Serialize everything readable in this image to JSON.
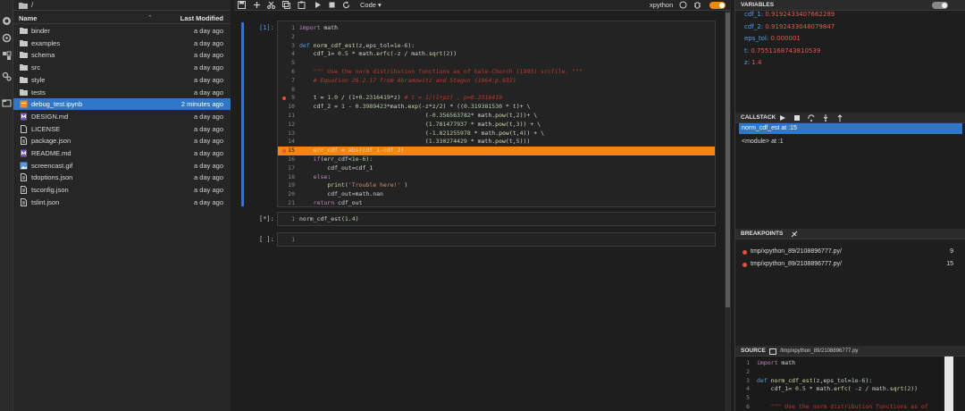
{
  "activity_bar": {
    "icons": [
      "running-icon",
      "git-icon",
      "extension-icon",
      "settings-icon",
      "tabs-icon"
    ]
  },
  "file_browser": {
    "path": "/",
    "headers": {
      "name": "Name",
      "sort_arrow": "⌃",
      "modified": "Last Modified"
    },
    "files": [
      {
        "name": "binder",
        "date": "a day ago",
        "type": "folder"
      },
      {
        "name": "examples",
        "date": "a day ago",
        "type": "folder"
      },
      {
        "name": "schema",
        "date": "a day ago",
        "type": "folder"
      },
      {
        "name": "src",
        "date": "a day ago",
        "type": "folder"
      },
      {
        "name": "style",
        "date": "a day ago",
        "type": "folder"
      },
      {
        "name": "tests",
        "date": "a day ago",
        "type": "folder"
      },
      {
        "name": "debug_test.ipynb",
        "date": "2 minutes ago",
        "type": "notebook",
        "selected": true
      },
      {
        "name": "DESIGN.md",
        "date": "a day ago",
        "type": "markdown"
      },
      {
        "name": "LICENSE",
        "date": "a day ago",
        "type": "file"
      },
      {
        "name": "package.json",
        "date": "a day ago",
        "type": "json"
      },
      {
        "name": "README.md",
        "date": "a day ago",
        "type": "markdown"
      },
      {
        "name": "screencast.gif",
        "date": "a day ago",
        "type": "image"
      },
      {
        "name": "tdoptions.json",
        "date": "a day ago",
        "type": "json"
      },
      {
        "name": "tsconfig.json",
        "date": "a day ago",
        "type": "json"
      },
      {
        "name": "tslint.json",
        "date": "a day ago",
        "type": "json"
      }
    ]
  },
  "notebook": {
    "cell_type": "Code",
    "kernel": "xpython",
    "accent_color": "#f0870f",
    "cells": [
      {
        "prompt": "[1]:",
        "lines": [
          [
            {
              "t": "import",
              "c": "kw"
            },
            {
              "t": " math",
              "c": "tx"
            }
          ],
          [],
          [
            {
              "t": "def",
              "c": "kb"
            },
            {
              "t": " ",
              "c": "tx"
            },
            {
              "t": "norm_cdf_est",
              "c": "fn"
            },
            {
              "t": "(z,eps_tol=",
              "c": "tx"
            },
            {
              "t": "1e-6",
              "c": "nm"
            },
            {
              "t": "):",
              "c": "tx"
            }
          ],
          [
            {
              "t": "    cdf_1= ",
              "c": "tx"
            },
            {
              "t": "0.5",
              "c": "nm"
            },
            {
              "t": " * math.",
              "c": "tx"
            },
            {
              "t": "erfc",
              "c": "fn"
            },
            {
              "t": "(-z / math.",
              "c": "tx"
            },
            {
              "t": "sqrt",
              "c": "fn"
            },
            {
              "t": "(",
              "c": "tx"
            },
            {
              "t": "2",
              "c": "nm"
            },
            {
              "t": "))",
              "c": "tx"
            }
          ],
          [],
          [
            {
              "t": "    \"\"\" Use the norm distribution functions as of Gale-Church (1993) srcfile. \"\"\"",
              "c": "cm"
            }
          ],
          [
            {
              "t": "    # Equation 26.2.17 from Abramowitz and Stegun (1964:p.932)",
              "c": "cmi"
            }
          ],
          [],
          [
            {
              "t": "    t = ",
              "c": "tx"
            },
            {
              "t": "1.0",
              "c": "nm"
            },
            {
              "t": " / (",
              "c": "tx"
            },
            {
              "t": "1",
              "c": "nm"
            },
            {
              "t": "+",
              "c": "tx"
            },
            {
              "t": "0.2316419",
              "c": "nm"
            },
            {
              "t": "*z) ",
              "c": "tx"
            },
            {
              "t": "# t = 1/(1+pz) , p=0.2316419",
              "c": "cmi"
            }
          ],
          [
            {
              "t": "    cdf_2 = ",
              "c": "tx"
            },
            {
              "t": "1",
              "c": "nm"
            },
            {
              "t": " - ",
              "c": "tx"
            },
            {
              "t": "0.3989423",
              "c": "nm"
            },
            {
              "t": "*math.",
              "c": "tx"
            },
            {
              "t": "exp",
              "c": "fn"
            },
            {
              "t": "(-z*z/",
              "c": "tx"
            },
            {
              "t": "2",
              "c": "nm"
            },
            {
              "t": ") * ((",
              "c": "tx"
            },
            {
              "t": "0.319381530",
              "c": "nm"
            },
            {
              "t": " * t)+ \\",
              "c": "tx"
            }
          ],
          [
            {
              "t": "                                    (-",
              "c": "tx"
            },
            {
              "t": "0.356563782",
              "c": "nm"
            },
            {
              "t": "* math.",
              "c": "tx"
            },
            {
              "t": "pow",
              "c": "fn"
            },
            {
              "t": "(t,",
              "c": "tx"
            },
            {
              "t": "2",
              "c": "nm"
            },
            {
              "t": "))+ \\",
              "c": "tx"
            }
          ],
          [
            {
              "t": "                                    (",
              "c": "tx"
            },
            {
              "t": "1.781477937",
              "c": "nm"
            },
            {
              "t": " * math.",
              "c": "tx"
            },
            {
              "t": "pow",
              "c": "fn"
            },
            {
              "t": "(t,",
              "c": "tx"
            },
            {
              "t": "3",
              "c": "nm"
            },
            {
              "t": ")) + \\",
              "c": "tx"
            }
          ],
          [
            {
              "t": "                                    (-",
              "c": "tx"
            },
            {
              "t": "1.821255978",
              "c": "nm"
            },
            {
              "t": " * math.",
              "c": "tx"
            },
            {
              "t": "pow",
              "c": "fn"
            },
            {
              "t": "(t,",
              "c": "tx"
            },
            {
              "t": "4",
              "c": "nm"
            },
            {
              "t": ")) + \\",
              "c": "tx"
            }
          ],
          [
            {
              "t": "                                    (",
              "c": "tx"
            },
            {
              "t": "1.330274429",
              "c": "nm"
            },
            {
              "t": " * math.",
              "c": "tx"
            },
            {
              "t": "pow",
              "c": "fn"
            },
            {
              "t": "(t,",
              "c": "tx"
            },
            {
              "t": "5",
              "c": "nm"
            },
            {
              "t": ")))",
              "c": "tx"
            }
          ],
          [
            {
              "t": "    err_cdf = ",
              "c": "tx"
            },
            {
              "t": "abs",
              "c": "tx"
            },
            {
              "t": "(cdf_1-cdf_2)",
              "c": "tx"
            }
          ],
          [
            {
              "t": "    ",
              "c": "tx"
            },
            {
              "t": "if",
              "c": "kw"
            },
            {
              "t": "(err_cdf<",
              "c": "tx"
            },
            {
              "t": "1e-6",
              "c": "nm"
            },
            {
              "t": "):",
              "c": "tx"
            }
          ],
          [
            {
              "t": "        cdf_out=cdf_1",
              "c": "tx"
            }
          ],
          [
            {
              "t": "    ",
              "c": "tx"
            },
            {
              "t": "else",
              "c": "kw"
            },
            {
              "t": ":",
              "c": "tx"
            }
          ],
          [
            {
              "t": "        ",
              "c": "tx"
            },
            {
              "t": "print",
              "c": "fn"
            },
            {
              "t": "(",
              "c": "tx"
            },
            {
              "t": "'Trouble here!'",
              "c": "st"
            },
            {
              "t": " )",
              "c": "tx"
            }
          ],
          [
            {
              "t": "        cdf_out=math.",
              "c": "tx"
            },
            {
              "t": "nan",
              "c": "tx"
            }
          ],
          [
            {
              "t": "    ",
              "c": "tx"
            },
            {
              "t": "return",
              "c": "kw"
            },
            {
              "t": " cdf_out",
              "c": "tx"
            }
          ]
        ],
        "breakpoints": [
          9,
          15
        ],
        "current_line": 15
      },
      {
        "prompt": "[*]:",
        "lines": [
          [
            {
              "t": "norm_cdf_est",
              "c": "tx"
            },
            {
              "t": "(",
              "c": "tx"
            },
            {
              "t": "1.4",
              "c": "nm"
            },
            {
              "t": ")",
              "c": "tx"
            }
          ]
        ]
      },
      {
        "prompt": "[ ]:",
        "lines": [
          []
        ]
      }
    ]
  },
  "debugger": {
    "variables_title": "VARIABLES",
    "variables": [
      {
        "name": "cdf_1",
        "value": "0.9192433407662289"
      },
      {
        "name": "cdf_2",
        "value": "0.9192433048079847"
      },
      {
        "name": "eps_tol",
        "value": "0.000001"
      },
      {
        "name": "t",
        "value": "0.7551168743810539"
      },
      {
        "name": "z",
        "value": "1.4"
      }
    ],
    "callstack_title": "CALLSTACK",
    "callstack": [
      {
        "label": "norm_cdf_est at :15",
        "selected": true
      },
      {
        "label": "<module> at :1"
      }
    ],
    "breakpoints_title": "BREAKPOINTS",
    "breakpoints": [
      {
        "path": "tmp/xpython_89/2108896777.py/",
        "line": "9"
      },
      {
        "path": "tmp/xpython_89/2108896777.py/",
        "line": "15"
      }
    ],
    "source_title": "SOURCE",
    "source_path": "/tmp/xpython_89/2108896777.py",
    "source_lines": [
      [
        {
          "t": "import",
          "c": "kw"
        },
        {
          "t": " math",
          "c": "tx"
        }
      ],
      [],
      [
        {
          "t": "def",
          "c": "kb"
        },
        {
          "t": " ",
          "c": "tx"
        },
        {
          "t": "norm_cdf_est",
          "c": "fn"
        },
        {
          "t": "(z,eps_tol=",
          "c": "tx"
        },
        {
          "t": "1e-6",
          "c": "nm"
        },
        {
          "t": "):",
          "c": "tx"
        }
      ],
      [
        {
          "t": "    cdf_1= ",
          "c": "tx"
        },
        {
          "t": "0.5",
          "c": "nm"
        },
        {
          "t": " * math.",
          "c": "tx"
        },
        {
          "t": "erfc",
          "c": "fn"
        },
        {
          "t": "( -z / math.",
          "c": "tx"
        },
        {
          "t": "sqrt",
          "c": "fn"
        },
        {
          "t": "(",
          "c": "tx"
        },
        {
          "t": "2",
          "c": "nm"
        },
        {
          "t": "))",
          "c": "tx"
        }
      ],
      [],
      [
        {
          "t": "    \"\"\" Use the norm distribution functions as of",
          "c": "cm"
        }
      ]
    ]
  }
}
